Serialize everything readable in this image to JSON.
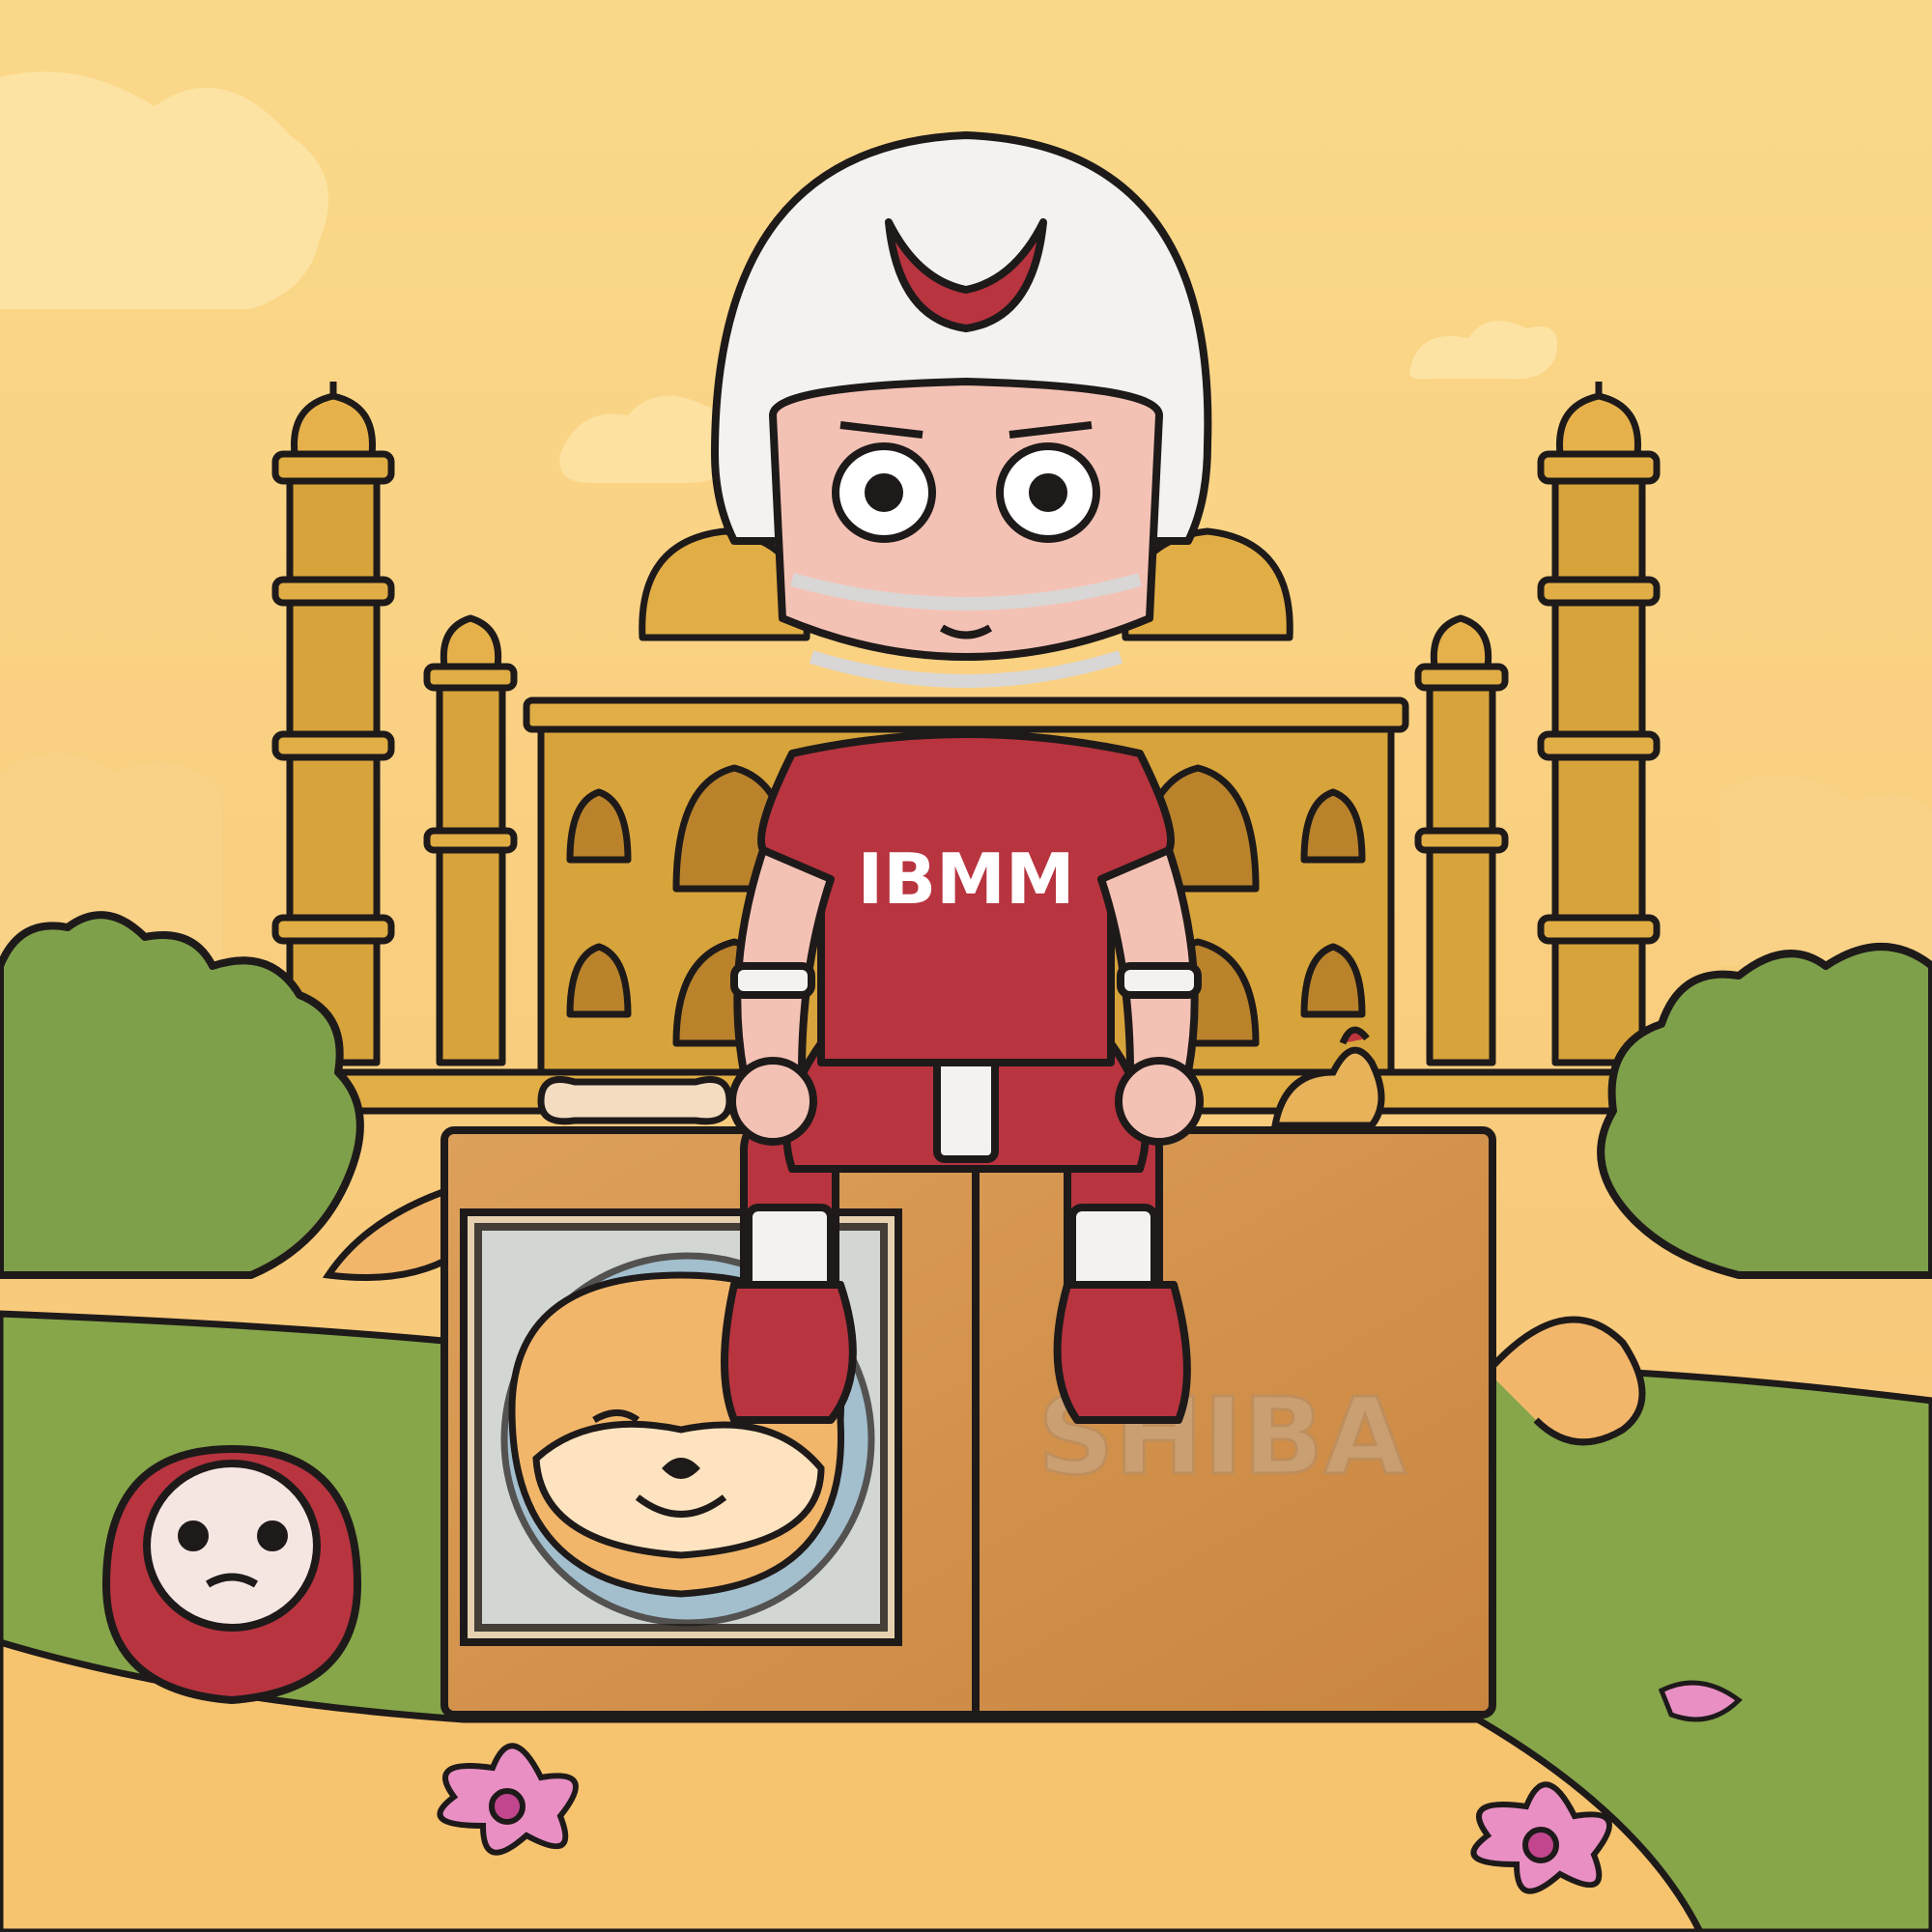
{
  "artwork": {
    "jersey_text": "IBMM",
    "box_text": "SHIBA"
  },
  "colors": {
    "sky_top": "#fbd98a",
    "sky_bottom": "#f9cc78",
    "cloud": "#fde4a6",
    "bush": "#7fa04a",
    "bush_dark": "#5f7e34",
    "grass": "#86a649",
    "path": "#f6c36e",
    "temple": "#d7a33b",
    "temple_dark": "#b9822b",
    "box": "#d6964d",
    "box_edge": "#b57636",
    "jersey": "#b8343f",
    "helmet": "#f4f1f0",
    "skin": "#f4c2b4",
    "shiba": "#f1b66a",
    "daruma": "#b8343f",
    "flower": "#e98fc4",
    "outline": "#1e1a1a"
  },
  "icons": [
    "cloud-icon",
    "minaret-icon",
    "dome-icon",
    "bush-icon",
    "daruma-icon",
    "shiba-face-icon",
    "rooster-icon",
    "flower-icon",
    "helmet-icon"
  ]
}
